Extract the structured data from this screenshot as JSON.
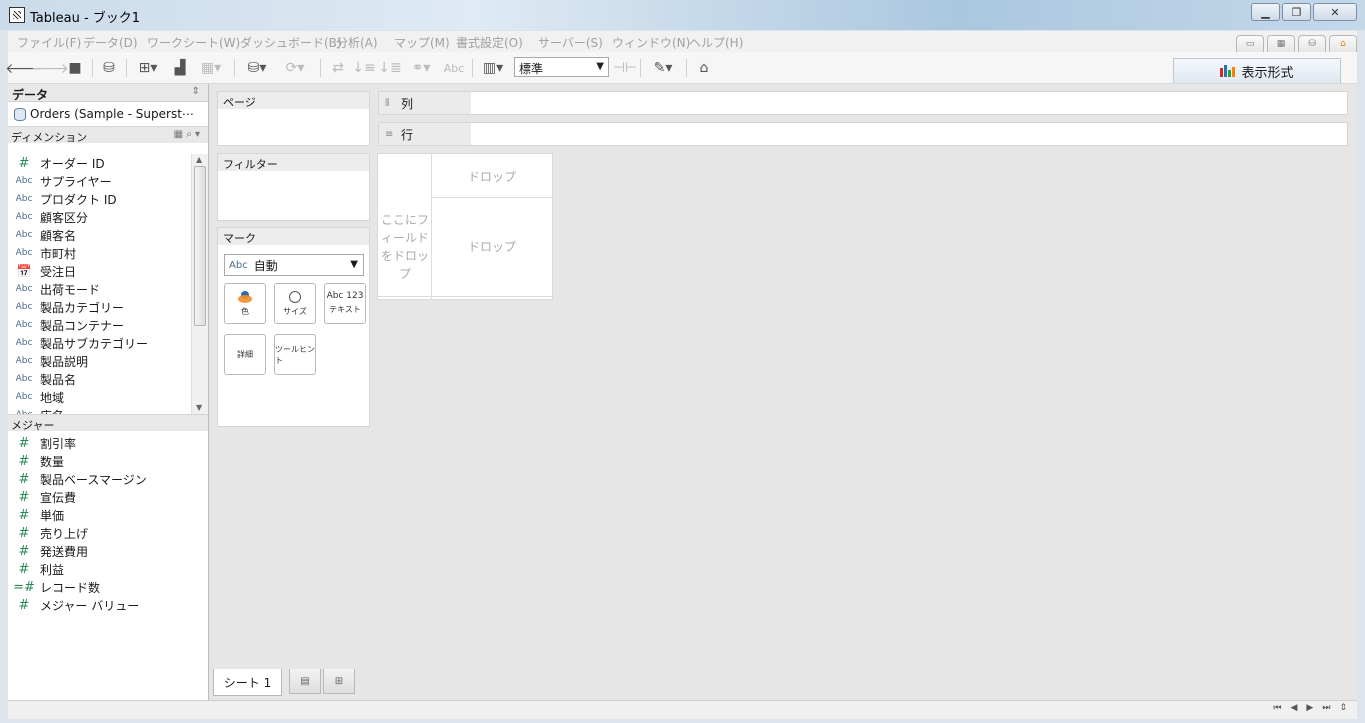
{
  "window": {
    "title": "Tableau - ブック1"
  },
  "menu": [
    "ファイル(F)",
    "データ(D)",
    "ワークシート(W)",
    "ダッシュボード(B)",
    "分析(A)",
    "マップ(M)",
    "書式設定(O)",
    "サーバー(S)",
    "ウィンドウ(N)",
    "ヘルプ(H)"
  ],
  "toolbar": {
    "fit_value": "標準",
    "abc_label": "Abc",
    "show_me": "表示形式"
  },
  "data_pane": {
    "header": "データ",
    "datasource": "Orders (Sample - Superst⋯",
    "dimensions_header": "ディメンション",
    "dimensions": [
      {
        "type": "#",
        "name": "オーダー ID"
      },
      {
        "type": "Abc",
        "name": "サプライヤー"
      },
      {
        "type": "Abc",
        "name": "プロダクト ID"
      },
      {
        "type": "Abc",
        "name": "顧客区分"
      },
      {
        "type": "Abc",
        "name": "顧客名"
      },
      {
        "type": "Abc",
        "name": "市町村"
      },
      {
        "type": "cal",
        "name": "受注日"
      },
      {
        "type": "Abc",
        "name": "出荷モード"
      },
      {
        "type": "Abc",
        "name": "製品カテゴリー"
      },
      {
        "type": "Abc",
        "name": "製品コンテナー"
      },
      {
        "type": "Abc",
        "name": "製品サブカテゴリー"
      },
      {
        "type": "Abc",
        "name": "製品説明"
      },
      {
        "type": "Abc",
        "name": "製品名"
      },
      {
        "type": "Abc",
        "name": "地域"
      },
      {
        "type": "Abc",
        "name": "店名"
      }
    ],
    "measures_header": "メジャー",
    "measures": [
      {
        "type": "#",
        "name": "割引率"
      },
      {
        "type": "#",
        "name": "数量"
      },
      {
        "type": "#",
        "name": "製品ベースマージン"
      },
      {
        "type": "#",
        "name": "宣伝費"
      },
      {
        "type": "#",
        "name": "単価"
      },
      {
        "type": "#",
        "name": "売り上げ"
      },
      {
        "type": "#",
        "name": "発送費用"
      },
      {
        "type": "#",
        "name": "利益"
      },
      {
        "type": "=#",
        "name": "レコード数"
      },
      {
        "type": "#",
        "name": "メジャー バリュー"
      }
    ]
  },
  "cards": {
    "pages": "ページ",
    "filters": "フィルター",
    "marks": "マーク",
    "marks_type_icon": "Abc",
    "marks_type": "自動",
    "buttons": {
      "color": "色",
      "size": "サイズ",
      "text": "テキスト",
      "text_icon": "Abc 123",
      "detail": "詳細",
      "tooltip": "ツールヒント"
    }
  },
  "shelves": {
    "columns": "列",
    "rows": "行"
  },
  "view": {
    "drop_top": "ドロップ",
    "drop_center": "ドロップ",
    "drop_left": "ここにフィールドをドロップ"
  },
  "sheets": {
    "tab": "シート 1"
  },
  "icons": [
    "back-arrow-icon",
    "forward-arrow-icon",
    "save-icon",
    "datasource-icon",
    "show-me-bars-icon"
  ]
}
